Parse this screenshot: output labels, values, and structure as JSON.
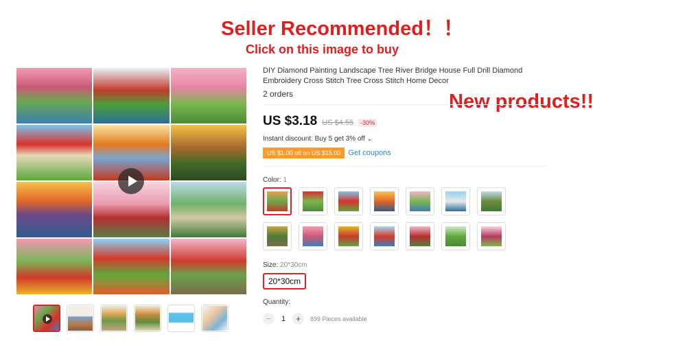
{
  "banner": {
    "title": "Seller Recommended！！",
    "subtitle": "Click on this image to buy",
    "new_products": "New products!!"
  },
  "gallery": {
    "tiles": [
      {
        "name": "tile-bridge-pink-trees",
        "bg": "linear-gradient(180deg,#f29bb0 0%,#c95a78 35%,#6aa84f 60%,#3d7fb5 100%)"
      },
      {
        "name": "tile-red-tree-bridge",
        "bg": "linear-gradient(180deg,#e7f1f8 0%,#c23b2a 40%,#4f9d3a 65%,#2b6e9a 100%)"
      },
      {
        "name": "tile-pink-garden-arch",
        "bg": "linear-gradient(180deg,#f4b2c4 0%,#e984a3 35%,#7bb64d 65%,#4c8a3c 100%)"
      },
      {
        "name": "tile-red-roof-house",
        "bg": "linear-gradient(180deg,#7fc4ec 0%,#d9312a 35%,#e6d9b8 55%,#5ca83c 100%)"
      },
      {
        "name": "tile-autumn-house",
        "bg": "linear-gradient(180deg,#f6e5a4 0%,#e57a1e 35%,#7aa4cf 60%,#c53a1f 100%)"
      },
      {
        "name": "tile-evening-cottage",
        "bg": "linear-gradient(180deg,#f0c24a 0%,#a86b2c 40%,#3f6b2a 70%,#2d4a20 100%)"
      },
      {
        "name": "tile-lighthouse-sunset",
        "bg": "linear-gradient(180deg,#f7c24e 0%,#e2652a 35%,#6a4a8a 60%,#2e5e8e 100%)"
      },
      {
        "name": "tile-pagoda-pink",
        "bg": "linear-gradient(180deg,#f5d5de 0%,#e99bb0 40%,#b52f2f 65%,#587e46 100%)"
      },
      {
        "name": "tile-green-cottage",
        "bg": "linear-gradient(180deg,#b9dceb 0%,#6fb267 40%,#d2c7a6 65%,#3e7d35 100%)"
      },
      {
        "name": "tile-gazebo-flowers",
        "bg": "linear-gradient(180deg,#f29bb4 0%,#7ab556 40%,#d3392a 70%,#e9b52b 100%)"
      },
      {
        "name": "tile-red-temple",
        "bg": "linear-gradient(180deg,#8fd3f2 0%,#d43b2b 35%,#5fa83e 65%,#e35c2b 100%)"
      },
      {
        "name": "tile-torii-gate",
        "bg": "linear-gradient(180deg,#f0b7c9 0%,#d13b2e 40%,#6aa24a 65%,#7c6a4e 100%)"
      }
    ]
  },
  "thumbnails": [
    {
      "name": "thumb-video",
      "bg": "linear-gradient(135deg,#e984a3,#6aa84f,#d9312a,#3d7fb5)"
    },
    {
      "name": "thumb-room-1",
      "bg": "linear-gradient(180deg,#f3eee6 0%,#f3eee6 40%,#7a9fc7 45%,#b87a4a 75%,#8a5a3a 100%)"
    },
    {
      "name": "thumb-room-2",
      "bg": "linear-gradient(180deg,#efe7d8 0%,#d8a24a 35%,#6a9a4a 60%,#c9a27a 100%)"
    },
    {
      "name": "thumb-framed",
      "bg": "linear-gradient(180deg,#f2e3c9 0%,#c98a3a 35%,#5b8d3e 65%,#e6d3b0 100%)"
    },
    {
      "name": "thumb-canvas-blue",
      "bg": "linear-gradient(180deg,#ffffff 0%,#ffffff 25%,#5bc0e8 30%,#5bc0e8 65%,#ffffff 70%)"
    },
    {
      "name": "thumb-package",
      "bg": "linear-gradient(135deg,#f4f4f4 0%,#e9c6a0 40%,#7db3d9 70%,#f4f4f4 100%)"
    }
  ],
  "product": {
    "title": "DIY Diamond Painting Landscape Tree River Bridge House Full Drill Diamond Embroidery Cross Stitch Tree Cross Stitch Home Decor",
    "orders": "2 orders",
    "price": "US $3.18",
    "old_price": "US $4.55",
    "discount": "-30%",
    "instant_discount": "Instant discount: Buy 5 get 3% off",
    "instant_chevron": "⌄",
    "coupon": "US $1.00 off on US $15.00",
    "get_coupons": "Get coupons",
    "color_label": "Color: ",
    "color_value": "1",
    "size_label": "Size: ",
    "size_value": "20*30cm",
    "size_option": "20*30cm",
    "quantity_label": "Quantity:",
    "quantity": "1",
    "minus": "−",
    "plus": "+",
    "available": "899 Pieces available"
  },
  "swatches": [
    {
      "name": "color-1",
      "bg": "linear-gradient(180deg,#e7a04a,#6aa84f,#c53a1f)"
    },
    {
      "name": "color-2",
      "bg": "linear-gradient(180deg,#d9312a,#7bb64d,#4c8a3c)"
    },
    {
      "name": "color-3",
      "bg": "linear-gradient(180deg,#7fc4ec,#d9312a,#5ca83c)"
    },
    {
      "name": "color-4",
      "bg": "linear-gradient(180deg,#f7c24e,#e2652a,#2e5e8e)"
    },
    {
      "name": "color-5",
      "bg": "linear-gradient(180deg,#f4b2c4,#7bb64d,#3d7fb5)"
    },
    {
      "name": "color-6",
      "bg": "linear-gradient(180deg,#8fd3f2,#e8e8e8,#2b6e9a)"
    },
    {
      "name": "color-7",
      "bg": "linear-gradient(180deg,#b9dceb,#6f8a3a,#3e7d35)"
    },
    {
      "name": "color-8",
      "bg": "linear-gradient(180deg,#c9a24a,#4f7d35,#7c6a4e)"
    },
    {
      "name": "color-9",
      "bg": "linear-gradient(180deg,#f29bb0,#c95a78,#3d7fb5)"
    },
    {
      "name": "color-10",
      "bg": "linear-gradient(180deg,#e9b52b,#c23b2a,#6aa24a)"
    },
    {
      "name": "color-11",
      "bg": "linear-gradient(180deg,#a9d4ee,#d43b2b,#3d7fb5)"
    },
    {
      "name": "color-12",
      "bg": "linear-gradient(180deg,#f0b7c9,#b52f2f,#587e46)"
    },
    {
      "name": "color-13",
      "bg": "linear-gradient(180deg,#d3e8c5,#5fa83e,#4c8a3c)"
    },
    {
      "name": "color-14",
      "bg": "linear-gradient(180deg,#f5d5de,#b83a5e,#7bb64d)"
    }
  ],
  "colors": {
    "accent": "#e02020",
    "coupon": "#ff9a2a",
    "link": "#2f86c7"
  }
}
